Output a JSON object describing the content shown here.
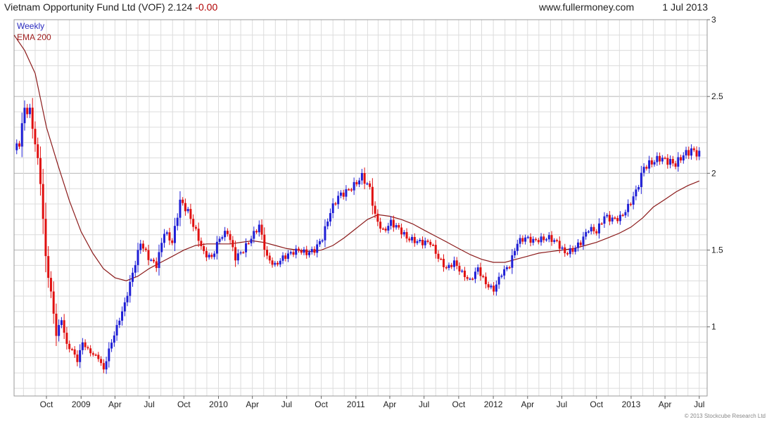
{
  "header": {
    "title": "Vietnam Opportunity Fund Ltd (VOF) 2.124",
    "change": "-0.00",
    "source": "www.fullermoney.com",
    "date": "1 Jul 2013"
  },
  "footer": {
    "copyright": "© 2013 Stockcube Research Ltd"
  },
  "colors": {
    "up": "#1f1fd6",
    "down": "#e01010",
    "ema": "#8b1a1a",
    "grid": "#dcdcdc",
    "grid_major": "#b8b8b8"
  },
  "chart_data": {
    "type": "ohlc-candlestick",
    "interval": "weekly",
    "ylim": [
      0.55,
      3.0
    ],
    "y_ticks": [
      1,
      1.5,
      2,
      2.5,
      3
    ],
    "y_tick_labels": [
      "1",
      "1.5",
      "2",
      "2.5",
      "3"
    ],
    "x_ticks": [
      "Oct",
      "2009",
      "Apr",
      "Jul",
      "Oct",
      "2010",
      "Apr",
      "Jul",
      "Oct",
      "2011",
      "Apr",
      "Jul",
      "Oct",
      "2012",
      "Apr",
      "Jul",
      "Oct",
      "2013",
      "Apr",
      "Jul"
    ],
    "x_tick_dates": [
      "2008-10-01",
      "2009-01-01",
      "2009-04-01",
      "2009-07-01",
      "2009-10-01",
      "2010-01-01",
      "2010-04-01",
      "2010-07-01",
      "2010-10-01",
      "2011-01-01",
      "2011-04-01",
      "2011-07-01",
      "2011-10-01",
      "2012-01-01",
      "2012-04-01",
      "2012-07-01",
      "2012-10-01",
      "2013-01-01",
      "2013-04-01",
      "2013-07-01"
    ],
    "xlim": [
      "2008-07-07",
      "2013-07-22"
    ],
    "legend": [
      {
        "label": "Weekly",
        "color": "#2b2bbf"
      },
      {
        "label": "EMA 200",
        "color": "#a02020"
      }
    ],
    "close_keyframes": [
      [
        "2008-07-07",
        2.15
      ],
      [
        "2008-07-21",
        2.2
      ],
      [
        "2008-08-04",
        2.42
      ],
      [
        "2008-08-18",
        2.4
      ],
      [
        "2008-09-01",
        2.2
      ],
      [
        "2008-09-15",
        1.95
      ],
      [
        "2008-09-29",
        1.45
      ],
      [
        "2008-10-13",
        1.22
      ],
      [
        "2008-10-27",
        0.95
      ],
      [
        "2008-11-10",
        1.05
      ],
      [
        "2008-11-24",
        0.88
      ],
      [
        "2008-12-08",
        0.85
      ],
      [
        "2008-12-22",
        0.78
      ],
      [
        "2009-01-05",
        0.9
      ],
      [
        "2009-01-19",
        0.85
      ],
      [
        "2009-02-02",
        0.82
      ],
      [
        "2009-02-16",
        0.8
      ],
      [
        "2009-03-02",
        0.72
      ],
      [
        "2009-03-16",
        0.85
      ],
      [
        "2009-04-06",
        1.0
      ],
      [
        "2009-04-27",
        1.15
      ],
      [
        "2009-05-18",
        1.35
      ],
      [
        "2009-06-08",
        1.55
      ],
      [
        "2009-06-29",
        1.45
      ],
      [
        "2009-07-20",
        1.4
      ],
      [
        "2009-08-10",
        1.62
      ],
      [
        "2009-08-31",
        1.55
      ],
      [
        "2009-09-21",
        1.82
      ],
      [
        "2009-10-12",
        1.75
      ],
      [
        "2009-11-02",
        1.62
      ],
      [
        "2009-11-23",
        1.48
      ],
      [
        "2009-12-14",
        1.45
      ],
      [
        "2010-01-04",
        1.58
      ],
      [
        "2010-01-25",
        1.62
      ],
      [
        "2010-02-15",
        1.45
      ],
      [
        "2010-03-08",
        1.5
      ],
      [
        "2010-03-29",
        1.58
      ],
      [
        "2010-04-19",
        1.66
      ],
      [
        "2010-05-10",
        1.45
      ],
      [
        "2010-05-31",
        1.4
      ],
      [
        "2010-06-21",
        1.45
      ],
      [
        "2010-07-12",
        1.48
      ],
      [
        "2010-08-02",
        1.5
      ],
      [
        "2010-08-23",
        1.48
      ],
      [
        "2010-09-13",
        1.5
      ],
      [
        "2010-10-04",
        1.58
      ],
      [
        "2010-10-25",
        1.75
      ],
      [
        "2010-11-15",
        1.85
      ],
      [
        "2010-12-06",
        1.88
      ],
      [
        "2010-12-27",
        1.92
      ],
      [
        "2011-01-17",
        1.98
      ],
      [
        "2011-02-07",
        1.9
      ],
      [
        "2011-02-21",
        1.72
      ],
      [
        "2011-03-14",
        1.62
      ],
      [
        "2011-04-04",
        1.68
      ],
      [
        "2011-04-25",
        1.64
      ],
      [
        "2011-05-16",
        1.58
      ],
      [
        "2011-06-06",
        1.56
      ],
      [
        "2011-06-27",
        1.55
      ],
      [
        "2011-07-18",
        1.55
      ],
      [
        "2011-08-08",
        1.45
      ],
      [
        "2011-08-29",
        1.38
      ],
      [
        "2011-09-19",
        1.42
      ],
      [
        "2011-10-10",
        1.35
      ],
      [
        "2011-10-31",
        1.3
      ],
      [
        "2011-11-21",
        1.38
      ],
      [
        "2011-12-12",
        1.28
      ],
      [
        "2012-01-02",
        1.24
      ],
      [
        "2012-01-23",
        1.35
      ],
      [
        "2012-02-13",
        1.4
      ],
      [
        "2012-03-05",
        1.55
      ],
      [
        "2012-03-26",
        1.58
      ],
      [
        "2012-04-16",
        1.56
      ],
      [
        "2012-05-07",
        1.57
      ],
      [
        "2012-05-28",
        1.58
      ],
      [
        "2012-06-18",
        1.55
      ],
      [
        "2012-07-09",
        1.48
      ],
      [
        "2012-07-30",
        1.5
      ],
      [
        "2012-08-20",
        1.55
      ],
      [
        "2012-09-10",
        1.64
      ],
      [
        "2012-10-01",
        1.62
      ],
      [
        "2012-10-22",
        1.72
      ],
      [
        "2012-11-12",
        1.7
      ],
      [
        "2012-12-03",
        1.71
      ],
      [
        "2012-12-24",
        1.78
      ],
      [
        "2013-01-14",
        1.88
      ],
      [
        "2013-02-04",
        2.04
      ],
      [
        "2013-02-25",
        2.07
      ],
      [
        "2013-03-18",
        2.1
      ],
      [
        "2013-04-08",
        2.08
      ],
      [
        "2013-04-29",
        2.06
      ],
      [
        "2013-05-20",
        2.12
      ],
      [
        "2013-06-10",
        2.15
      ],
      [
        "2013-07-01",
        2.124
      ]
    ],
    "ema_200": [
      [
        "2008-07-07",
        2.9
      ],
      [
        "2008-08-04",
        2.8
      ],
      [
        "2008-09-01",
        2.65
      ],
      [
        "2008-10-01",
        2.3
      ],
      [
        "2008-11-01",
        2.05
      ],
      [
        "2008-12-01",
        1.82
      ],
      [
        "2009-01-01",
        1.62
      ],
      [
        "2009-02-01",
        1.48
      ],
      [
        "2009-03-01",
        1.38
      ],
      [
        "2009-04-01",
        1.32
      ],
      [
        "2009-05-01",
        1.3
      ],
      [
        "2009-06-01",
        1.33
      ],
      [
        "2009-07-01",
        1.38
      ],
      [
        "2009-08-01",
        1.42
      ],
      [
        "2009-09-01",
        1.46
      ],
      [
        "2009-10-01",
        1.5
      ],
      [
        "2009-11-01",
        1.53
      ],
      [
        "2009-12-01",
        1.54
      ],
      [
        "2010-01-01",
        1.54
      ],
      [
        "2010-02-01",
        1.54
      ],
      [
        "2010-03-01",
        1.55
      ],
      [
        "2010-04-01",
        1.56
      ],
      [
        "2010-05-01",
        1.55
      ],
      [
        "2010-06-01",
        1.53
      ],
      [
        "2010-07-01",
        1.51
      ],
      [
        "2010-08-01",
        1.5
      ],
      [
        "2010-09-01",
        1.49
      ],
      [
        "2010-10-01",
        1.5
      ],
      [
        "2010-11-01",
        1.53
      ],
      [
        "2010-12-01",
        1.58
      ],
      [
        "2011-01-01",
        1.64
      ],
      [
        "2011-02-01",
        1.7
      ],
      [
        "2011-03-01",
        1.73
      ],
      [
        "2011-04-01",
        1.72
      ],
      [
        "2011-05-01",
        1.7
      ],
      [
        "2011-06-01",
        1.67
      ],
      [
        "2011-07-01",
        1.63
      ],
      [
        "2011-08-01",
        1.59
      ],
      [
        "2011-09-01",
        1.55
      ],
      [
        "2011-10-01",
        1.51
      ],
      [
        "2011-11-01",
        1.47
      ],
      [
        "2011-12-01",
        1.44
      ],
      [
        "2012-01-01",
        1.42
      ],
      [
        "2012-02-01",
        1.42
      ],
      [
        "2012-03-01",
        1.44
      ],
      [
        "2012-04-01",
        1.46
      ],
      [
        "2012-05-01",
        1.48
      ],
      [
        "2012-06-01",
        1.49
      ],
      [
        "2012-07-01",
        1.5
      ],
      [
        "2012-08-01",
        1.51
      ],
      [
        "2012-09-01",
        1.53
      ],
      [
        "2012-10-01",
        1.55
      ],
      [
        "2012-11-01",
        1.58
      ],
      [
        "2012-12-01",
        1.61
      ],
      [
        "2013-01-01",
        1.65
      ],
      [
        "2013-02-01",
        1.71
      ],
      [
        "2013-03-01",
        1.78
      ],
      [
        "2013-04-01",
        1.83
      ],
      [
        "2013-05-01",
        1.88
      ],
      [
        "2013-06-01",
        1.92
      ],
      [
        "2013-07-01",
        1.95
      ]
    ],
    "grid": true,
    "y_axis_side": "right"
  }
}
